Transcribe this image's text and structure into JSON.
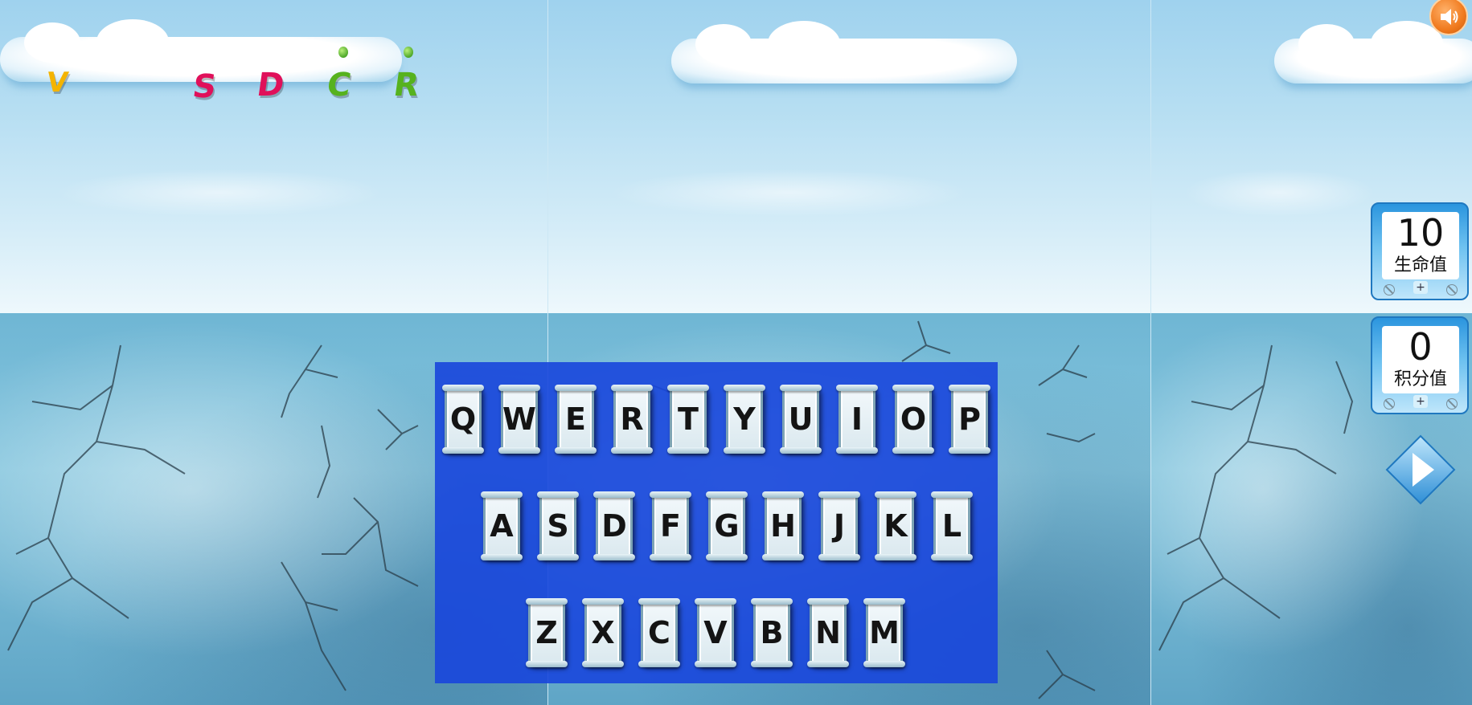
{
  "colors": {
    "keyboard_panel": "#1846dc",
    "sky_top": "#9fd2ee",
    "wall": "#6fb6d4",
    "sound_button": "#f07a1e",
    "stat_box": "#2b95de"
  },
  "falling_letters": [
    {
      "char": "V",
      "color": "#f4b400"
    },
    {
      "char": "S",
      "color": "#e0105a"
    },
    {
      "char": "D",
      "color": "#e0105a"
    },
    {
      "char": "C",
      "color": "#56b21e"
    },
    {
      "char": "R",
      "color": "#56b21e"
    }
  ],
  "keyboard": {
    "rows": [
      [
        "Q",
        "W",
        "E",
        "R",
        "T",
        "Y",
        "U",
        "I",
        "O",
        "P"
      ],
      [
        "A",
        "S",
        "D",
        "F",
        "G",
        "H",
        "J",
        "K",
        "L"
      ],
      [
        "Z",
        "X",
        "C",
        "V",
        "B",
        "N",
        "M"
      ]
    ]
  },
  "hud": {
    "sound_icon": "speaker-icon",
    "life": {
      "value": "10",
      "label": "生命值",
      "plus": "+"
    },
    "score": {
      "value": "0",
      "label": "积分值",
      "plus": "+"
    },
    "play_icon": "play-icon"
  }
}
